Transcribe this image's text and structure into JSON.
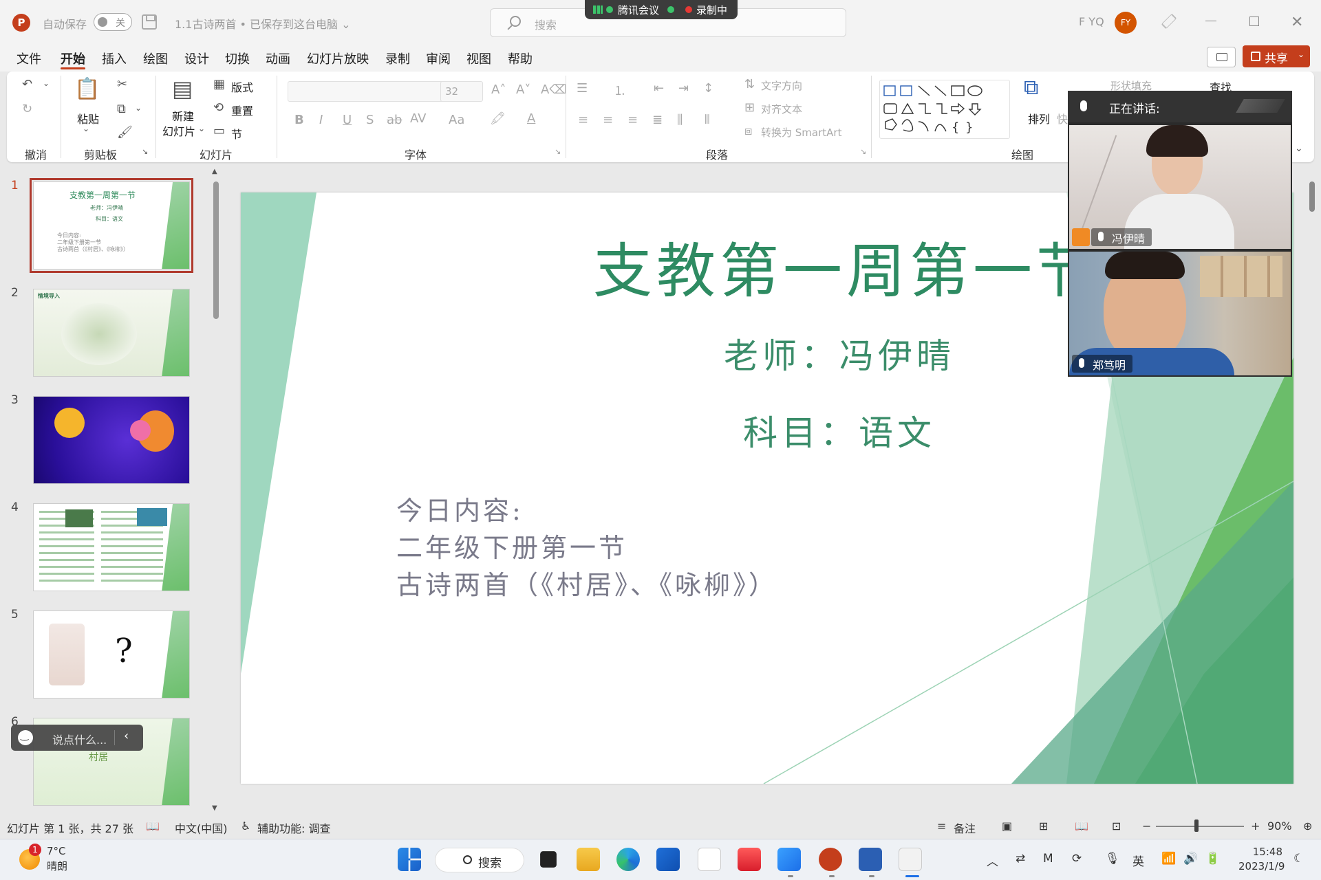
{
  "titlebar": {
    "autosave_label": "自动保存",
    "autosave_state": "关",
    "doc_title": "1.1古诗两首 • 已保存到这台电脑 ⌄",
    "search_placeholder": "搜索",
    "meeting_name": "腾讯会议",
    "recording": "录制中",
    "user_name": "F YQ",
    "avatar_initials": "FY"
  },
  "menu": {
    "tabs": [
      "文件",
      "开始",
      "插入",
      "绘图",
      "设计",
      "切换",
      "动画",
      "幻灯片放映",
      "录制",
      "审阅",
      "视图",
      "帮助"
    ],
    "active_tab": "开始",
    "share_label": "共享"
  },
  "ribbon": {
    "groups": {
      "undo": "撤消",
      "clipboard": "剪贴板",
      "slides": "幻灯片",
      "font": "字体",
      "paragraph": "段落",
      "drawing": "绘图"
    },
    "paste": "粘贴",
    "new_slide_1": "新建",
    "new_slide_2": "幻灯片",
    "layout": "版式",
    "reset": "重置",
    "section": "节",
    "font_size": "32",
    "text_direction": "文字方向",
    "align_text": "对齐文本",
    "convert_smartart": "转换为 SmartArt",
    "arrange": "排列",
    "quick_styles": "快速",
    "shape_fill": "形状填充",
    "find": "查找"
  },
  "thumbnails": {
    "numbers": [
      "1",
      "2",
      "3",
      "4",
      "5",
      "6"
    ],
    "slide1_title": "支教第一周第一节",
    "slide1_teacher": "老师：冯伊晴",
    "slide1_subject": "科目：语文",
    "slide1_body": [
      "今日内容:",
      "二年级下册第一节",
      "古诗两首（《村居》、《咏柳》）"
    ],
    "slide2_label": "情境导入",
    "slide6_label": "村居",
    "chat_placeholder": "说点什么..."
  },
  "slide": {
    "title": "支教第一周第一节",
    "teacher": "老师：冯伊晴",
    "subject": "科目：语文",
    "body": [
      "今日内容:",
      "二年级下册第一节",
      "古诗两首（《村居》、《咏柳》）"
    ]
  },
  "video": {
    "speaking_label": "正在讲话:",
    "participant_1": "冯伊晴",
    "participant_2": "郑笃明"
  },
  "status": {
    "slide_info": "幻灯片 第 1 张，共 27 张",
    "language": "中文(中国)",
    "accessibility": "辅助功能: 调查",
    "notes": "备注",
    "zoom": "90%"
  },
  "taskbar": {
    "weather_badge": "1",
    "temperature": "7°C",
    "weather": "晴朗",
    "search_label": "搜索",
    "ime": "英",
    "time": "15:48",
    "date": "2023/1/9"
  },
  "colors": {
    "accent": "#c43e1c",
    "slide_green": "#2e8b62"
  }
}
